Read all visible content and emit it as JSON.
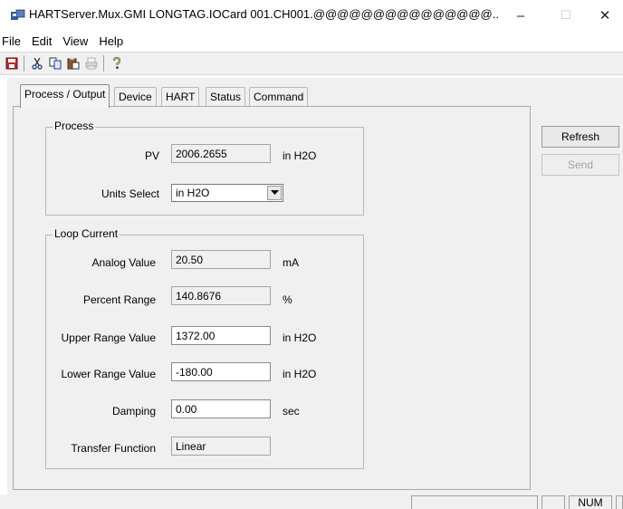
{
  "window": {
    "title": "HARTServer.Mux.GMI LONGTAG.IOCard 001.CH001.@@@@@@@@@@@@@@@..",
    "minimize_glyph": "–",
    "maximize_glyph": "☐",
    "close_glyph": "✕"
  },
  "menu": [
    "File",
    "Edit",
    "View",
    "Help"
  ],
  "toolbar": {
    "icons": [
      "save-icon",
      "cut-icon",
      "copy-icon",
      "paste-icon",
      "print-icon",
      "help-icon"
    ]
  },
  "tabs": [
    {
      "label": "Process / Output",
      "active": true
    },
    {
      "label": "Device",
      "active": false
    },
    {
      "label": "HART",
      "active": false
    },
    {
      "label": "Status",
      "active": false
    },
    {
      "label": "Command",
      "active": false
    }
  ],
  "process": {
    "title": "Process",
    "pv_label": "PV",
    "pv_value": "2006.2655",
    "pv_unit": "in H2O",
    "units_label": "Units Select",
    "units_value": "in H2O"
  },
  "loop": {
    "title": "Loop Current",
    "analog_label": "Analog Value",
    "analog_value": "20.50",
    "analog_unit": "mA",
    "percent_label": "Percent Range",
    "percent_value": "140.8676",
    "percent_unit": "%",
    "urv_label": "Upper Range Value",
    "urv_value": "1372.00",
    "urv_unit": "in H2O",
    "lrv_label": "Lower Range Value",
    "lrv_value": "-180.00",
    "lrv_unit": "in H2O",
    "damping_label": "Damping",
    "damping_value": "0.00",
    "damping_unit": "sec",
    "transfer_label": "Transfer Function",
    "transfer_value": "Linear"
  },
  "buttons": {
    "refresh": "Refresh",
    "send": "Send"
  },
  "status": {
    "num": "NUM"
  },
  "colors": {
    "background": "#f0f0f0",
    "disabled_text": "#a0a0a0"
  }
}
